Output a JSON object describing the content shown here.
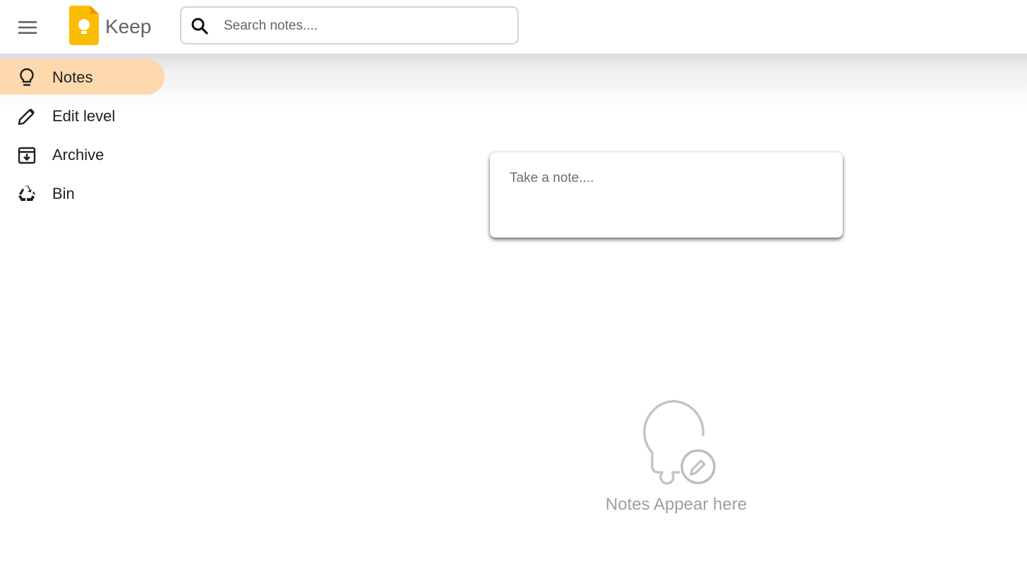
{
  "header": {
    "menu_icon": "hamburger-menu-icon",
    "logo_icon": "keep-logo-icon",
    "app_title": "Keep",
    "search": {
      "icon": "search-icon",
      "placeholder": "Search notes....",
      "value": ""
    }
  },
  "sidebar": {
    "active_color": "#fed9ad",
    "items": [
      {
        "label": "Notes",
        "icon": "lightbulb-icon",
        "active": true
      },
      {
        "label": "Edit level",
        "icon": "pencil-icon",
        "active": false
      },
      {
        "label": "Archive",
        "icon": "archive-icon",
        "active": false
      },
      {
        "label": "Bin",
        "icon": "recycle-icon",
        "active": false
      }
    ]
  },
  "main": {
    "note_input": {
      "placeholder": "Take a note....",
      "value": ""
    },
    "empty_state": {
      "icon": "lightbulb-edit-icon",
      "text": "Notes Appear here"
    }
  },
  "colors": {
    "logo_yellow": "#fbbc04",
    "text_muted": "#9aa0a6"
  }
}
